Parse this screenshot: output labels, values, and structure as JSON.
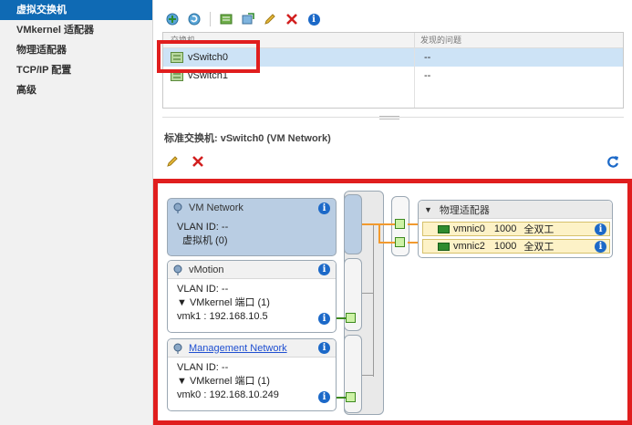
{
  "sidebar": {
    "items": [
      {
        "label": "虚拟交换机",
        "active": true
      },
      {
        "label": "VMkernel 适配器",
        "active": false
      },
      {
        "label": "物理适配器",
        "active": false
      },
      {
        "label": "TCP/IP 配置",
        "active": false
      },
      {
        "label": "高级",
        "active": false
      }
    ]
  },
  "toolbar": {
    "icons": [
      "add-host-networking-icon",
      "refresh-network-icon",
      "add-vswitch-icon",
      "migrate-icon",
      "edit-icon",
      "delete-icon",
      "info-icon"
    ]
  },
  "switch_table": {
    "columns": [
      "交换机",
      "发现的问题"
    ],
    "rows": [
      {
        "name": "vSwitch0",
        "issues": "--",
        "selected": true
      },
      {
        "name": "vSwitch1",
        "issues": "--",
        "selected": false
      }
    ]
  },
  "detail": {
    "title": "标准交换机: vSwitch0 (VM Network)"
  },
  "diagram": {
    "port_groups": [
      {
        "name": "VM Network",
        "vlan": "VLAN ID: --",
        "line2": "虚拟机 (0)",
        "line3": ""
      },
      {
        "name": "vMotion",
        "vlan": "VLAN ID: --",
        "line2": "▼ VMkernel 端口 (1)",
        "line3": "vmk1 : 192.168.10.5"
      },
      {
        "name": "Management Network",
        "vlan": "VLAN ID: --",
        "line2": "▼ VMkernel 端口 (1)",
        "line3": "vmk0 : 192.168.10.249"
      }
    ],
    "adapters_title": "物理适配器",
    "nics": [
      {
        "name": "vmnic0",
        "speed": "1000",
        "duplex": "全双工"
      },
      {
        "name": "vmnic2",
        "speed": "1000",
        "duplex": "全双工"
      }
    ]
  },
  "colors": {
    "accent": "#0f6ab4",
    "highlight_red": "#e01e1e",
    "selection": "#cde3f6",
    "uplink_wire": "#f29a2e",
    "nic_row": "#fdf2c7"
  }
}
